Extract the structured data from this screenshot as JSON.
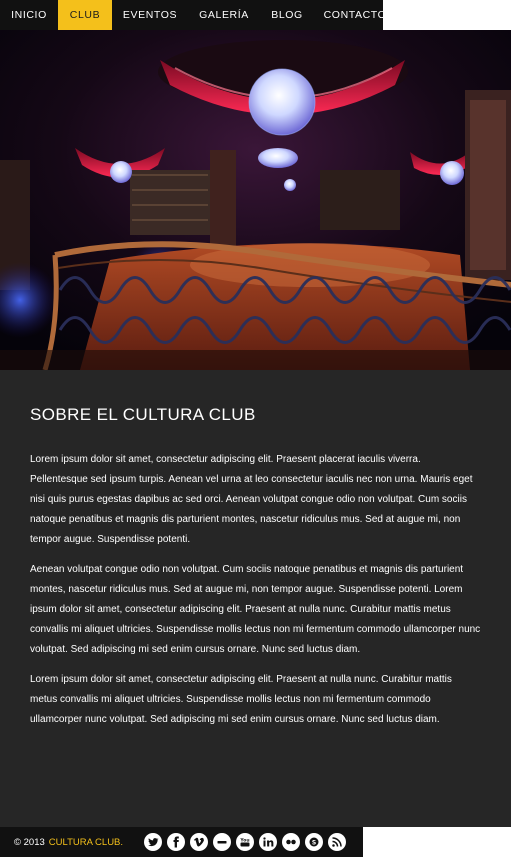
{
  "nav": {
    "items": [
      {
        "label": "Inicio",
        "active": false
      },
      {
        "label": "Club",
        "active": true
      },
      {
        "label": "Eventos",
        "active": false
      },
      {
        "label": "Galería",
        "active": false
      },
      {
        "label": "Blog",
        "active": false
      },
      {
        "label": "Contacto",
        "active": false
      }
    ]
  },
  "hero": {
    "colors": {
      "accent": "#f4c01b",
      "curtain": "#d0143a",
      "floor": "#b23a1a",
      "light": "#2e5bff"
    }
  },
  "content": {
    "title": "SOBRE EL CULTURA CLUB",
    "paragraphs": [
      "Lorem ipsum dolor sit amet, consectetur adipiscing elit. Praesent placerat iaculis viverra. Pellentesque sed ipsum turpis. Aenean vel urna at leo consectetur iaculis nec non urna. Mauris eget nisi quis purus egestas dapibus ac sed orci. Aenean volutpat congue odio non volutpat. Cum sociis natoque penatibus et magnis dis parturient montes, nascetur ridiculus mus. Sed at augue mi, non tempor augue. Suspendisse potenti.",
      "Aenean volutpat congue odio non volutpat. Cum sociis natoque penatibus et magnis dis parturient montes, nascetur ridiculus mus. Sed at augue mi, non tempor augue. Suspendisse potenti. Lorem ipsum dolor sit amet, consectetur adipiscing elit. Praesent at nulla nunc. Curabitur mattis metus convallis mi aliquet ultricies. Suspendisse mollis lectus non mi fermentum commodo ullamcorper nunc volutpat. Sed adipiscing mi sed enim cursus ornare. Nunc sed luctus diam.",
      "Lorem ipsum dolor sit amet, consectetur adipiscing elit. Praesent at nulla nunc. Curabitur mattis metus convallis mi aliquet ultricies. Suspendisse mollis lectus non mi fermentum commodo ullamcorper nunc volutpat. Sed adipiscing mi sed enim cursus ornare. Nunc sed luctus diam."
    ]
  },
  "footer": {
    "copyright": "© 2013",
    "brand": "CULTURA CLUB.",
    "social": [
      {
        "icon": "twitter-icon"
      },
      {
        "icon": "facebook-icon"
      },
      {
        "icon": "vimeo-icon"
      },
      {
        "icon": "myspace-icon"
      },
      {
        "icon": "youtube-icon"
      },
      {
        "icon": "linkedin-icon"
      },
      {
        "icon": "flickr-icon"
      },
      {
        "icon": "skype-icon"
      },
      {
        "icon": "rss-icon"
      }
    ]
  }
}
